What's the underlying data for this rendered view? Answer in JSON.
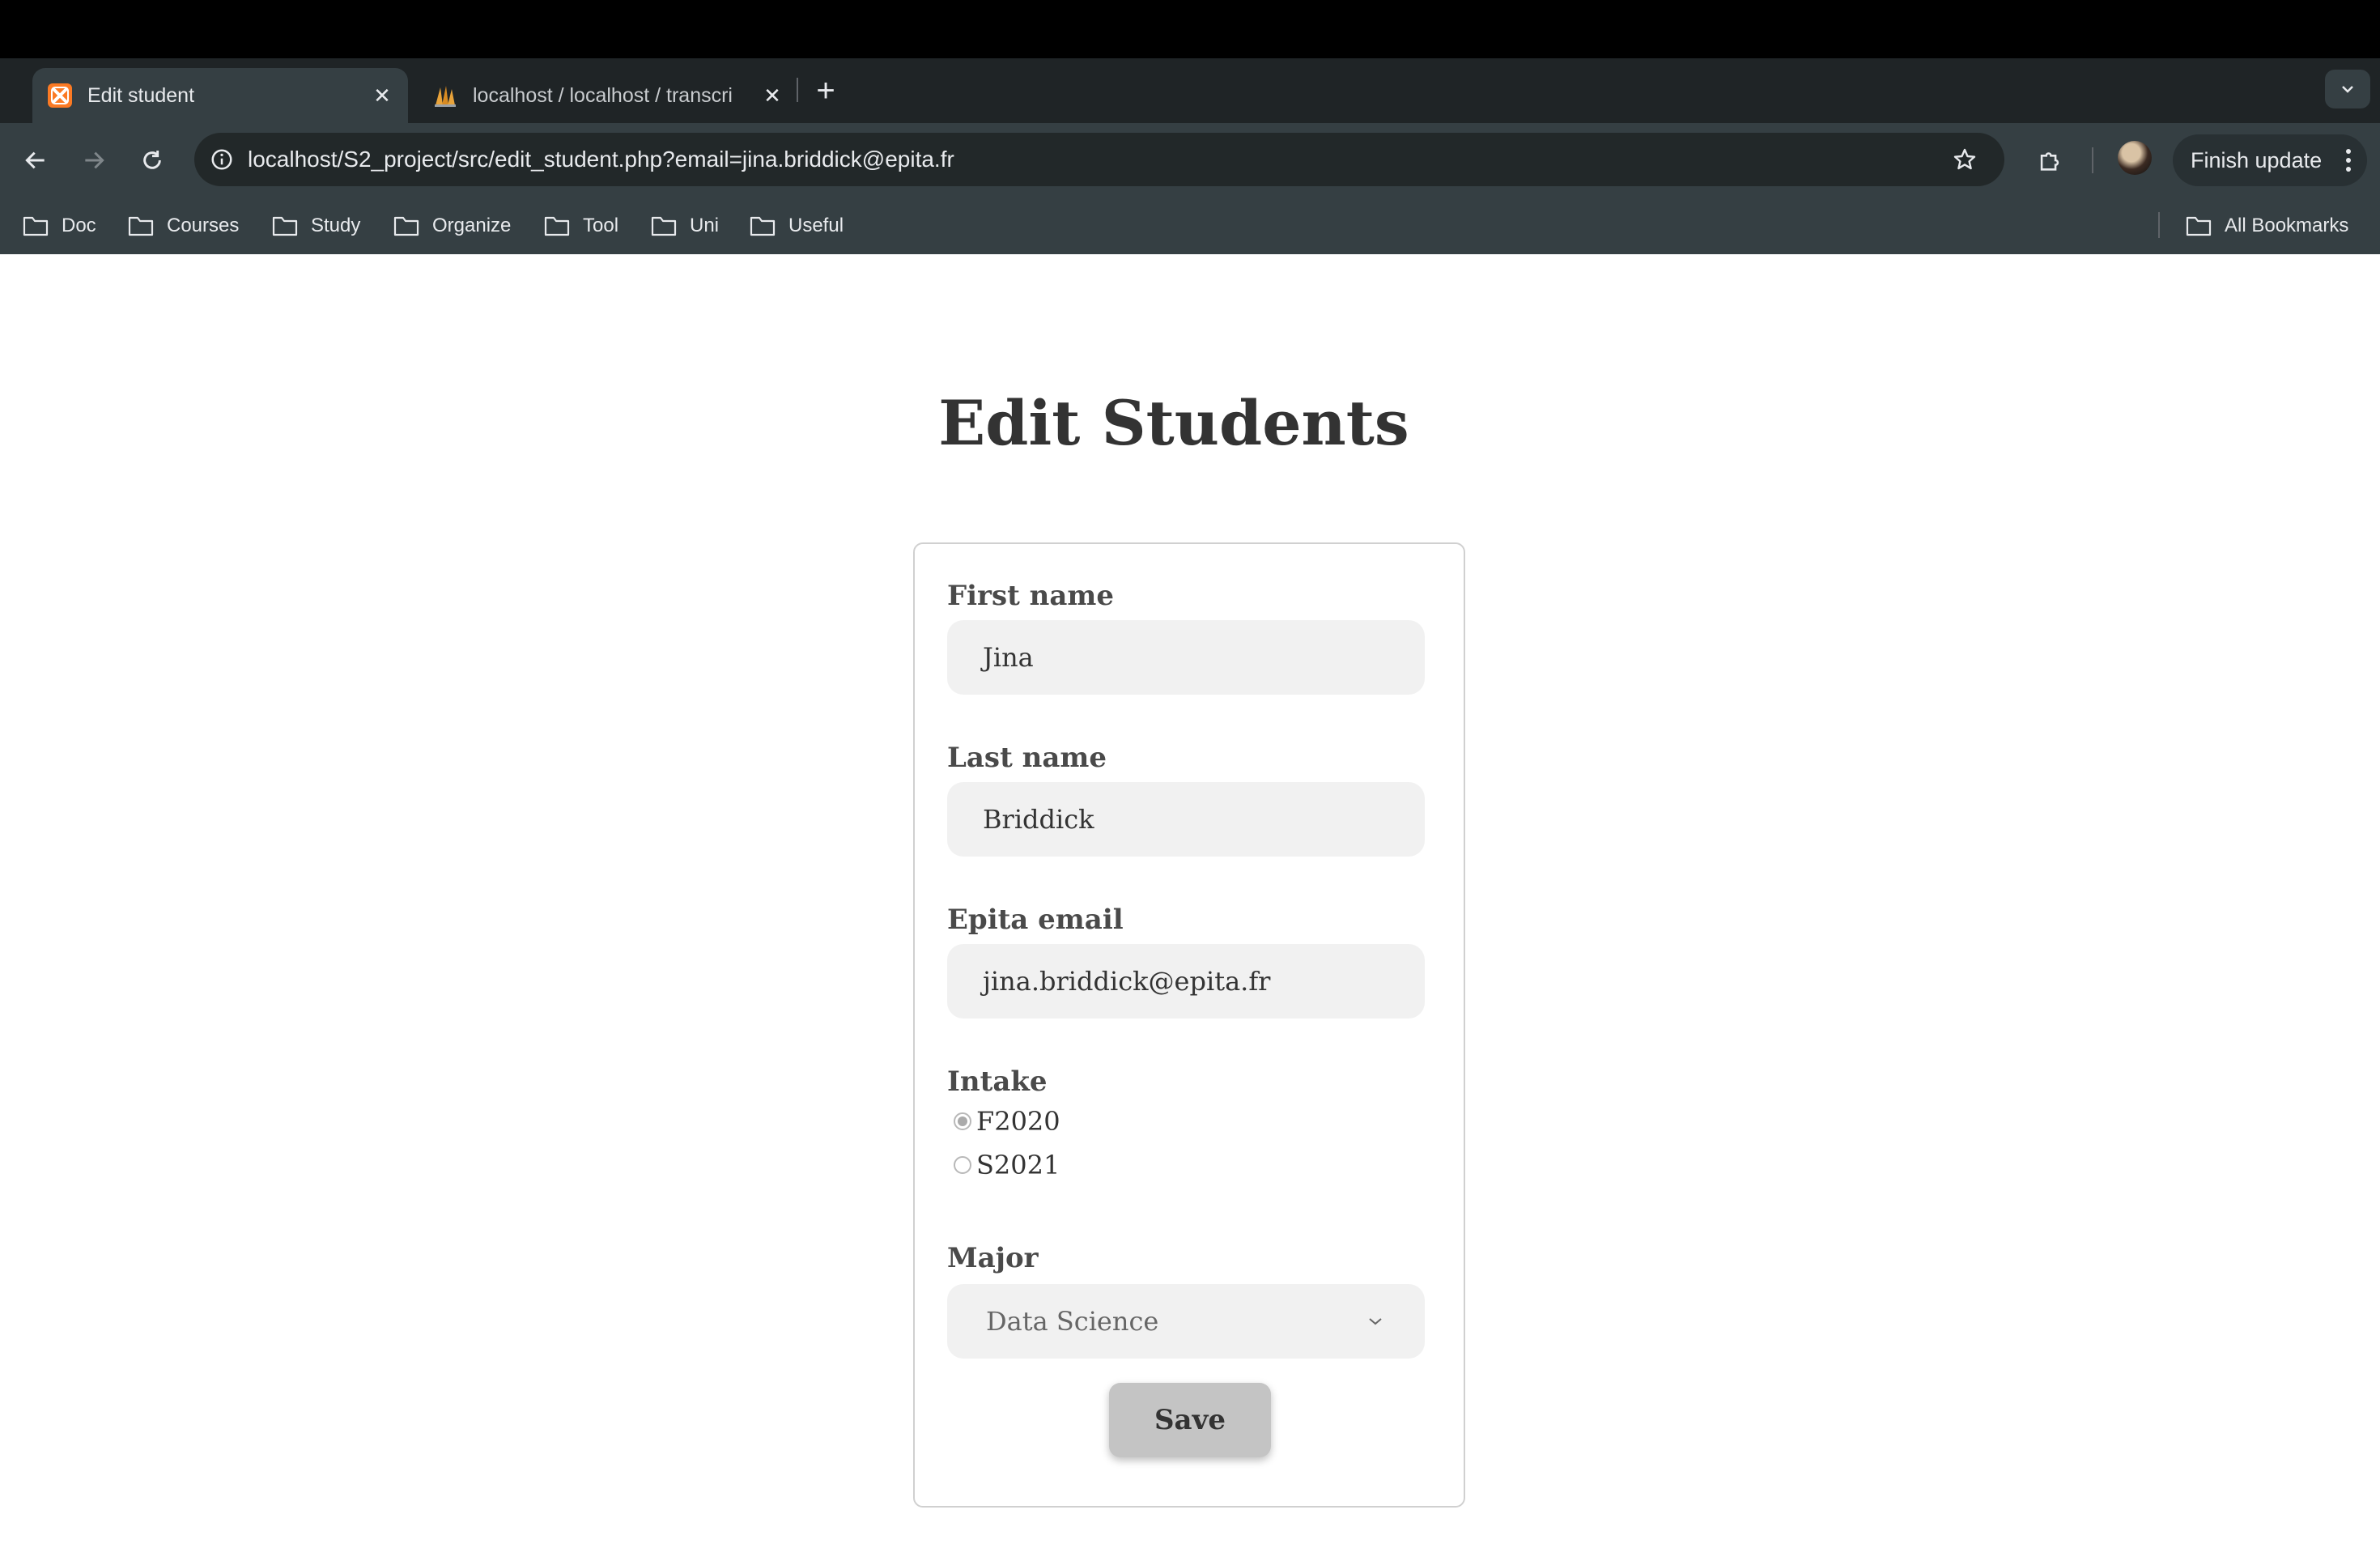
{
  "browser": {
    "tabs": [
      {
        "title": "Edit student",
        "active": true,
        "icon": "xampp-icon"
      },
      {
        "title": "localhost / localhost / transcri",
        "active": false,
        "icon": "phpmyadmin-icon"
      }
    ],
    "url": "localhost/S2_project/src/edit_student.php?email=jina.briddick@epita.fr",
    "update_button": "Finish update",
    "bookmarks": [
      "Doc",
      "Courses",
      "Study",
      "Organize",
      "Tool",
      "Uni",
      "Useful"
    ],
    "all_bookmarks": "All Bookmarks"
  },
  "page": {
    "title": "Edit Students",
    "form": {
      "first_name": {
        "label": "First name",
        "value": "Jina"
      },
      "last_name": {
        "label": "Last name",
        "value": "Briddick"
      },
      "email": {
        "label": "Epita email",
        "value": "jina.briddick@epita.fr"
      },
      "intake": {
        "label": "Intake",
        "options": [
          {
            "label": "F2020",
            "checked": true
          },
          {
            "label": "S2021",
            "checked": false
          }
        ]
      },
      "major": {
        "label": "Major",
        "selected": "Data Science"
      },
      "save_label": "Save"
    }
  },
  "colors": {
    "tab_strip": "#1f2426",
    "toolbar": "#353f43",
    "omnibox": "#222829",
    "input_bg": "#f1f1f1",
    "button_bg": "#c4c4c4",
    "title_text": "#333333"
  }
}
